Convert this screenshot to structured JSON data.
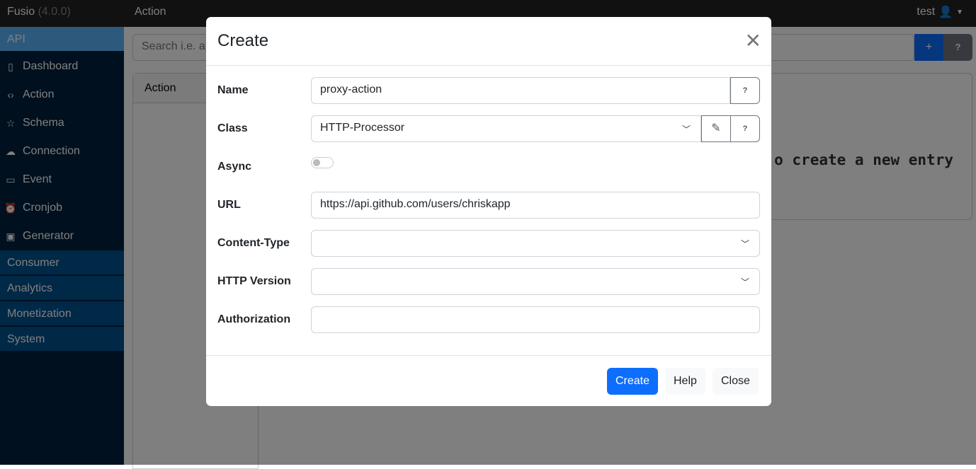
{
  "topbar": {
    "brand": "Fusio",
    "version": "(4.0.0)",
    "page_title": "Action",
    "user": "test",
    "user_icon": "person-icon"
  },
  "sidebar": {
    "api_label": "API",
    "items": [
      {
        "label": "Dashboard",
        "icon": "tablet-icon",
        "glyph": "▯"
      },
      {
        "label": "Action",
        "icon": "code-icon",
        "glyph": "‹›"
      },
      {
        "label": "Schema",
        "icon": "star-icon",
        "glyph": "☆"
      },
      {
        "label": "Connection",
        "icon": "cloud-icon",
        "glyph": "☁"
      },
      {
        "label": "Event",
        "icon": "calendar-icon",
        "glyph": "▭"
      },
      {
        "label": "Cronjob",
        "icon": "alarm-icon",
        "glyph": "⏰"
      },
      {
        "label": "Generator",
        "icon": "cpu-icon",
        "glyph": "▣"
      }
    ],
    "sections": [
      "Consumer",
      "Analytics",
      "Monetization",
      "System"
    ]
  },
  "main": {
    "search_placeholder": "Search i.e. a",
    "add_label": "+",
    "help_label": "?",
    "list_header": "Action",
    "empty_text": "o create a new entry"
  },
  "modal": {
    "title": "Create",
    "fields": {
      "name": {
        "label": "Name",
        "value": "proxy-action"
      },
      "class": {
        "label": "Class",
        "value": "HTTP-Processor"
      },
      "async": {
        "label": "Async",
        "value": false
      },
      "url": {
        "label": "URL",
        "value": "https://api.github.com/users/chriskapp"
      },
      "content_type": {
        "label": "Content-Type",
        "value": ""
      },
      "http_version": {
        "label": "HTTP Version",
        "value": ""
      },
      "authorization": {
        "label": "Authorization",
        "value": ""
      }
    },
    "help_addon": "?",
    "buttons": {
      "create": "Create",
      "help": "Help",
      "close": "Close"
    }
  }
}
